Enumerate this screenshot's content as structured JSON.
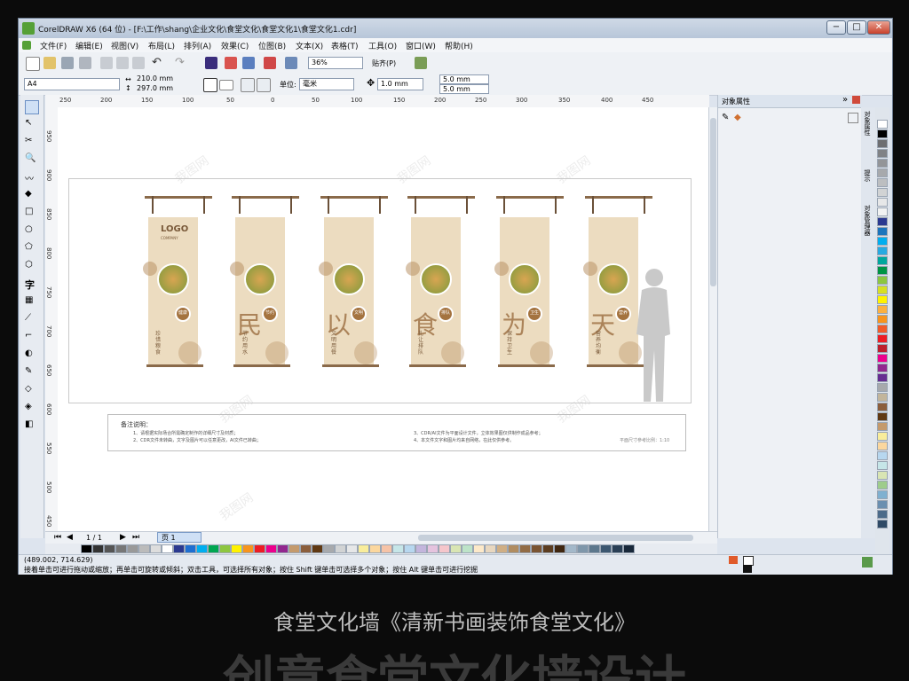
{
  "window": {
    "title": "CorelDRAW X6 (64 位) - [F:\\工作\\shang\\企业文化\\食堂文化\\食堂文化1\\食堂文化1.cdr]",
    "buttons": {
      "minimize": "−",
      "maximize": "□",
      "close": "✕"
    }
  },
  "menu": [
    "文件(F)",
    "编辑(E)",
    "视图(V)",
    "布局(L)",
    "排列(A)",
    "效果(C)",
    "位图(B)",
    "文本(X)",
    "表格(T)",
    "工具(O)",
    "窗口(W)",
    "帮助(H)"
  ],
  "toolbar1": {
    "zoom": "36%",
    "snap": "贴齐(P)"
  },
  "toolbar2": {
    "page_size": "A4",
    "width": "210.0 mm",
    "height": "297.0 mm",
    "unit_label": "单位:",
    "unit": "毫米",
    "nudge": "1.0 mm",
    "dup_x": "5.0 mm",
    "dup_y": "5.0 mm"
  },
  "ruler": {
    "top_ticks": [
      "250",
      "200",
      "150",
      "100",
      "50",
      "0",
      "50",
      "100",
      "150",
      "200",
      "250",
      "300",
      "350",
      "400",
      "450"
    ],
    "left_ticks": [
      "950",
      "900",
      "850",
      "800",
      "750",
      "700",
      "650",
      "600",
      "550",
      "500",
      "450"
    ]
  },
  "docker": {
    "title": "对象属性",
    "side_tabs": [
      "对象属性",
      "提示"
    ],
    "side_tab_text": "对象管理器"
  },
  "document": {
    "banners": [
      {
        "logo": "LOGO",
        "logo_sub": "COMPANY",
        "calli": "",
        "tag1": "健康",
        "text": "珍惜粮食"
      },
      {
        "logo": "",
        "logo_sub": "",
        "calli": "民",
        "tag1": "节约",
        "text": "节约用水"
      },
      {
        "logo": "",
        "logo_sub": "",
        "calli": "以",
        "tag1": "文明",
        "text": "文明用餐"
      },
      {
        "logo": "",
        "logo_sub": "",
        "calli": "食",
        "tag1": "排队",
        "text": "礼让排队"
      },
      {
        "logo": "",
        "logo_sub": "",
        "calli": "为",
        "tag1": "卫生",
        "text": "保持卫生"
      },
      {
        "logo": "",
        "logo_sub": "",
        "calli": "天",
        "tag1": "营养",
        "text": "营养均衡"
      }
    ],
    "notes": {
      "title": "备注说明：",
      "items": [
        "1、请根据实际场合所需确定制作的详细尺寸及材质；",
        "2、CDR文件未转曲，文字及图片可以任意更改，AI文件已转曲；",
        "3、CDR/AI文件为平面设计文件，立体效果图仅供制作成品参考；",
        "4、本文件文字和图片均来自网络，在此仅供参考。"
      ],
      "scale": "平面尺寸参考比例：1:10"
    }
  },
  "pager": {
    "pages": "1 / 1",
    "page_tab": "页 1"
  },
  "status": {
    "coords": "(489.002, 714.629)",
    "hint": "接着单击可进行拖动或缩放；再单击可旋转或倾斜；双击工具，可选择所有对象；按住 Shift 键单击可选择多个对象；按住 Alt 键单击可进行挖掘"
  },
  "caption": {
    "line1": "食堂文化墙《清新书画装饰食堂文化》",
    "line2": "创意食堂文化墙设计"
  },
  "watermark": "我图网",
  "colors": {
    "banner": "#ecdcc0",
    "brown": "#8a6a4a",
    "accent": "#55a037"
  },
  "palette_colors": [
    "#000000",
    "#333333",
    "#555555",
    "#777777",
    "#999999",
    "#bbbbbb",
    "#dddddd",
    "#ffffff",
    "#2b3990",
    "#1f6fd1",
    "#00aeef",
    "#00a651",
    "#8dc63f",
    "#fff200",
    "#f7941d",
    "#ed1c24",
    "#ec008c",
    "#92278f",
    "#c49a6c",
    "#8b5e3c",
    "#603913",
    "#a7a9ac",
    "#d1d3d4",
    "#e6e7e8",
    "#f9ed9b",
    "#fbd79e",
    "#f6c3a7",
    "#c6e6e8",
    "#b7d7ef",
    "#c3b5dc",
    "#e5c3de",
    "#f5c6cb",
    "#d9e5b3",
    "#bde3c8",
    "#fde9c9",
    "#e8d7bf",
    "#cfae84",
    "#b08c60",
    "#926c45",
    "#7a5432",
    "#5c3d20",
    "#402710",
    "#a3b8c9",
    "#7f97aa",
    "#5c778c",
    "#3c5770",
    "#2a3f55",
    "#18283a"
  ],
  "right_palette": [
    "#ffffff",
    "#000000",
    "#6d6e71",
    "#808285",
    "#939598",
    "#a7a9ac",
    "#bcbec0",
    "#d1d3d4",
    "#e6e7e8",
    "#f1f2f2",
    "#2b3990",
    "#1c75bc",
    "#00aeef",
    "#27aae1",
    "#00a79d",
    "#009444",
    "#8dc63f",
    "#d7df23",
    "#fff200",
    "#fbb040",
    "#f7941d",
    "#f15a29",
    "#ed1c24",
    "#be1e2d",
    "#ec008c",
    "#92278f",
    "#662d91",
    "#a7a9ac",
    "#c2b59b",
    "#8b5e3c",
    "#603913",
    "#c49a6c",
    "#f9ed9b",
    "#fbd79e",
    "#b7d7ef",
    "#c6e6e8",
    "#d9e5b3",
    "#9ecc8b",
    "#7fb0d0",
    "#6a8fb0",
    "#4c6b8a",
    "#2f4a66"
  ]
}
